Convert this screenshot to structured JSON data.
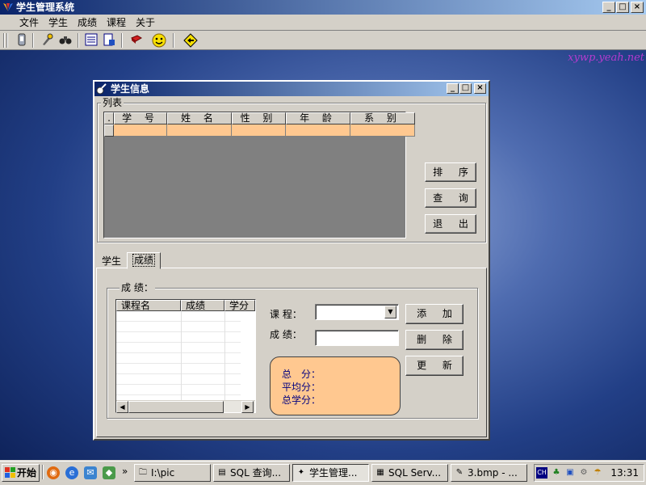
{
  "app": {
    "title": "学生管理系统",
    "menu": [
      "文件",
      "学生",
      "成绩",
      "课程",
      "关于"
    ],
    "window_controls": [
      "_",
      "□",
      "×"
    ],
    "toolbar_icons": [
      "database-icon",
      "tools-icon",
      "binoculars-icon",
      "list-icon",
      "report-icon",
      "book-icon",
      "smiley-icon",
      "help-icon"
    ],
    "watermark": "xywp.yeah.net"
  },
  "window": {
    "title": "学生信息",
    "controls": [
      "_",
      "□",
      "×"
    ],
    "list_group_label": "列表",
    "grid": {
      "row_marker": ".",
      "columns": [
        "学 号",
        "姓 名",
        "性 别",
        "年 龄",
        "系 别"
      ],
      "rows": [
        [
          "",
          "",
          "",
          "",
          ""
        ]
      ]
    },
    "buttons": {
      "sort": "排 序",
      "query": "查 询",
      "exit": "退 出"
    },
    "tabs": [
      "学生",
      "成绩"
    ],
    "active_tab": 1,
    "score_group_label": "成 绩：",
    "course_list": {
      "columns": [
        "课程名",
        "成绩",
        "学分"
      ],
      "row_count": 8
    },
    "course_label": "课 程：",
    "score_label": "成 绩：",
    "course_value": "",
    "score_value": "",
    "actions": {
      "add": "添 加",
      "delete": "删 除",
      "refresh": "更 新"
    },
    "summary": {
      "total": "总　分：",
      "average": "平均分：",
      "total_credits": "总学分："
    }
  },
  "taskbar": {
    "start": "开始",
    "overflow": "»",
    "tasks": [
      {
        "icon": "folder-icon",
        "label": "I:\\pic",
        "active": false
      },
      {
        "icon": "sql-query-icon",
        "label": "SQL 查询...",
        "active": false
      },
      {
        "icon": "app-icon",
        "label": "学生管理...",
        "active": true
      },
      {
        "icon": "sql-server-icon",
        "label": "SQL Serv...",
        "active": false
      },
      {
        "icon": "paint-icon",
        "label": "3.bmp - ...",
        "active": false
      }
    ],
    "tray_ime": "CH",
    "clock": "13:31"
  },
  "colors": {
    "accent": "#ffc890",
    "title_start": "#0a246a",
    "title_end": "#a6caf0",
    "face": "#d4d0c8"
  }
}
